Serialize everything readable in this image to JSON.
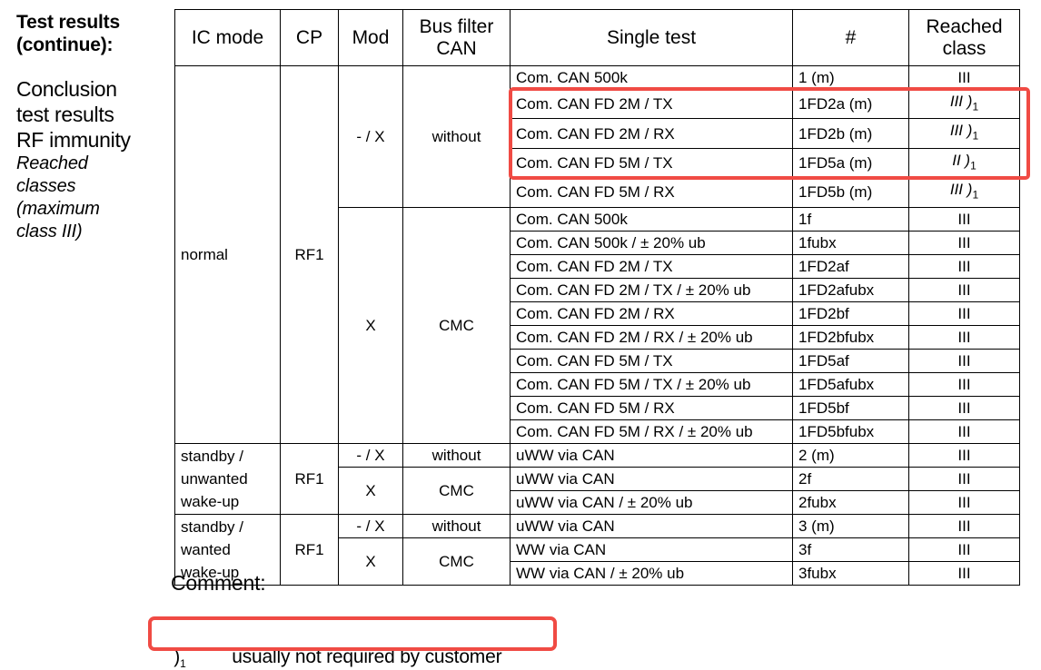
{
  "left_panel": {
    "title_line1": "Test results",
    "title_line2": "(continue):",
    "conclusion_line1": "Conclusion",
    "conclusion_line2": "test results",
    "conclusion_line3": "RF immunity",
    "italic_line1": "Reached",
    "italic_line2": "classes",
    "italic_line3": "(maximum",
    "italic_line4": "class III)"
  },
  "table": {
    "headers": {
      "ic_mode": "IC mode",
      "cp": "CP",
      "mod": "Mod",
      "bus_filter": "Bus filter CAN",
      "bus_filter_line1": "Bus filter",
      "bus_filter_line2": "CAN",
      "single_test": "Single test",
      "number": "#",
      "reached_class": "Reached class",
      "reached_class_line1": "Reached",
      "reached_class_line2": "class"
    },
    "groups": [
      {
        "ic_mode": "normal",
        "cp": "RF1",
        "subgroups": [
          {
            "mod": "- / X",
            "bus_filter": "without",
            "rows": [
              {
                "single_test": "Com. CAN 500k",
                "number": "1 (m)",
                "reached_class": "III",
                "highlighted": false
              },
              {
                "single_test": "Com. CAN FD 2M / TX",
                "number": "1FD2a (m)",
                "reached_class": "III",
                "footnote": ")1",
                "highlighted": true
              },
              {
                "single_test": "Com. CAN FD 2M / RX",
                "number": "1FD2b (m)",
                "reached_class": "III",
                "footnote": ")1",
                "highlighted": true
              },
              {
                "single_test": "Com. CAN FD 5M / TX",
                "number": "1FD5a (m)",
                "reached_class": "II",
                "footnote": ")1",
                "highlighted": true
              },
              {
                "single_test": "Com. CAN FD 5M / RX",
                "number": "1FD5b (m)",
                "reached_class": "III",
                "footnote": ")1",
                "highlighted": true
              }
            ]
          },
          {
            "mod": "X",
            "bus_filter": "CMC",
            "rows": [
              {
                "single_test": "Com. CAN 500k",
                "number": "1f",
                "reached_class": "III"
              },
              {
                "single_test": "Com. CAN 500k / ± 20% ub",
                "number": "1fubx",
                "reached_class": "III"
              },
              {
                "single_test": "Com. CAN FD 2M / TX",
                "number": "1FD2af",
                "reached_class": "III"
              },
              {
                "single_test": "Com. CAN FD 2M / TX / ± 20% ub",
                "number": "1FD2afubx",
                "reached_class": "III"
              },
              {
                "single_test": "Com. CAN FD 2M / RX",
                "number": "1FD2bf",
                "reached_class": "III"
              },
              {
                "single_test": "Com. CAN FD 2M / RX / ± 20% ub",
                "number": "1FD2bfubx",
                "reached_class": "III"
              },
              {
                "single_test": "Com. CAN FD 5M / TX",
                "number": "1FD5af",
                "reached_class": "III"
              },
              {
                "single_test": "Com. CAN FD 5M / TX / ± 20% ub",
                "number": "1FD5afubx",
                "reached_class": "III"
              },
              {
                "single_test": "Com. CAN FD 5M / RX",
                "number": "1FD5bf",
                "reached_class": "III"
              },
              {
                "single_test": "Com. CAN FD 5M / RX / ± 20% ub",
                "number": "1FD5bfubx",
                "reached_class": "III"
              }
            ]
          }
        ]
      },
      {
        "ic_mode": "standby / unwanted wake-up",
        "ic_mode_line1": "standby /",
        "ic_mode_line2": "unwanted",
        "ic_mode_line3": "wake-up",
        "cp": "RF1",
        "subgroups": [
          {
            "mod": "- / X",
            "bus_filter": "without",
            "rows": [
              {
                "single_test": "uWW via CAN",
                "number": "2 (m)",
                "reached_class": "III"
              }
            ]
          },
          {
            "mod": "X",
            "bus_filter": "CMC",
            "rows": [
              {
                "single_test": "uWW via CAN",
                "number": "2f",
                "reached_class": "III"
              },
              {
                "single_test": "uWW via CAN / ± 20% ub",
                "number": "2fubx",
                "reached_class": "III"
              }
            ]
          }
        ]
      },
      {
        "ic_mode": "standby / wanted wake-up",
        "ic_mode_line1": "standby /",
        "ic_mode_line2": "wanted",
        "ic_mode_line3": "wake-up",
        "cp": "RF1",
        "subgroups": [
          {
            "mod": "- / X",
            "bus_filter": "without",
            "rows": [
              {
                "single_test": "uWW via CAN",
                "number": "3 (m)",
                "reached_class": "III"
              }
            ]
          },
          {
            "mod": "X",
            "bus_filter": "CMC",
            "rows": [
              {
                "single_test": "WW via CAN",
                "number": "3f",
                "reached_class": "III"
              },
              {
                "single_test": "WW via CAN / ± 20% ub",
                "number": "3fubx",
                "reached_class": "III"
              }
            ]
          }
        ]
      }
    ]
  },
  "comment": {
    "label": "Comment:",
    "footnote_marker": ")1",
    "footnote_text": "usually not required by customer",
    "full_text": ")1          usually not required by customer"
  },
  "colors": {
    "highlight_red": "#F04B44",
    "table_border": "#000000",
    "text": "#000000"
  }
}
